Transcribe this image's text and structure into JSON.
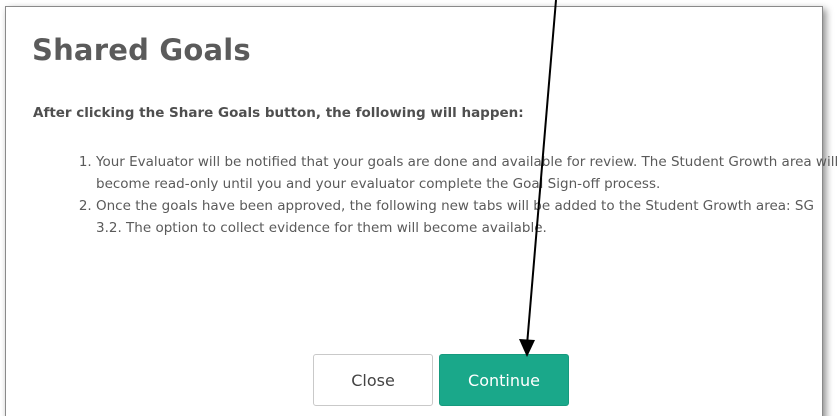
{
  "dialog": {
    "title": "Shared Goals",
    "intro": "After clicking the Share Goals button, the following will happen:",
    "steps": [
      "Your Evaluator will be notified that your goals are done and available for review. The Student Growth area will become read-only until you and your evaluator complete the Goal Sign-off process.",
      "Once the goals have been approved, the following new tabs will be added to the Student Growth area: SG 3.2. The option to collect evidence for them will become available."
    ],
    "buttons": {
      "close_label": "Close",
      "continue_label": "Continue"
    }
  },
  "colors": {
    "accent": "#1aa88a",
    "title": "#5b5b5b",
    "annotation_arrow": "#000000"
  },
  "icons": {
    "annotation": "arrow-down-icon"
  }
}
